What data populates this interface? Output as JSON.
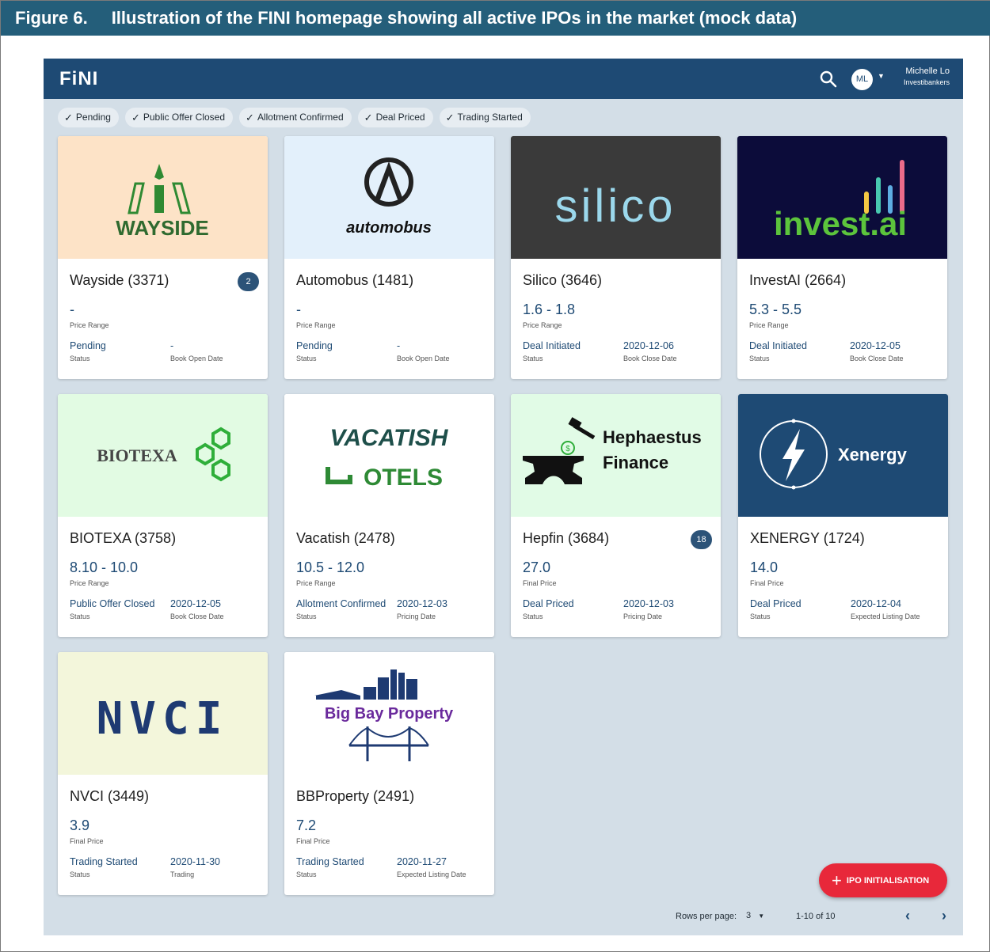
{
  "figure": {
    "number": "Figure 6.",
    "caption": "Illustration of the FINI homepage showing all active IPOs in the market (mock data)"
  },
  "appbar": {
    "logo": "FiNI",
    "user_initials": "ML",
    "user_name": "Michelle Lo",
    "user_org": "Investibankers"
  },
  "filters": [
    {
      "label": "Pending"
    },
    {
      "label": "Public Offer Closed"
    },
    {
      "label": "Allotment Confirmed"
    },
    {
      "label": "Deal Priced"
    },
    {
      "label": "Trading Started"
    }
  ],
  "cards": [
    {
      "title": "Wayside (3371)",
      "badge": "2",
      "price": "-",
      "price_label": "Price Range",
      "status": "Pending",
      "status_label": "Status",
      "date": "-",
      "date_label": "Book Open Date",
      "logo_text": "WAYSIDE",
      "bg": "#fde3c7"
    },
    {
      "title": "Automobus (1481)",
      "badge": "",
      "price": "-",
      "price_label": "Price Range",
      "status": "Pending",
      "status_label": "Status",
      "date": "-",
      "date_label": "Book Open Date",
      "logo_text": "automobus",
      "bg": "#e3f0fb"
    },
    {
      "title": "Silico (3646)",
      "badge": "",
      "price": "1.6 - 1.8",
      "price_label": "Price Range",
      "status": "Deal Initiated",
      "status_label": "Status",
      "date": "2020-12-06",
      "date_label": "Book Close Date",
      "logo_text": "silico",
      "bg": "#3a3a3a"
    },
    {
      "title": "InvestAI (2664)",
      "badge": "",
      "price": "5.3 - 5.5",
      "price_label": "Price Range",
      "status": "Deal Initiated",
      "status_label": "Status",
      "date": "2020-12-05",
      "date_label": "Book Close Date",
      "logo_text": "invest.ai",
      "bg": "#0c0c3a"
    },
    {
      "title": "BIOTEXA (3758)",
      "badge": "",
      "price": "8.10 - 10.0",
      "price_label": "Price Range",
      "status": "Public Offer Closed",
      "status_label": "Status",
      "date": "2020-12-05",
      "date_label": "Book Close Date",
      "logo_text": "BIOTEXA",
      "bg": "#e2fbe3"
    },
    {
      "title": "Vacatish (2478)",
      "badge": "",
      "price": "10.5 - 12.0",
      "price_label": "Price Range",
      "status": "Allotment Confirmed",
      "status_label": "Status",
      "date": "2020-12-03",
      "date_label": "Pricing Date",
      "logo_text": "VACATISH",
      "logo_text2": "OTELS",
      "bg": "#ffffff"
    },
    {
      "title": "Hepfin (3684)",
      "badge": "18",
      "price": "27.0",
      "price_label": "Final Price",
      "status": "Deal Priced",
      "status_label": "Status",
      "date": "2020-12-03",
      "date_label": "Pricing Date",
      "logo_text": "Hephaestus",
      "logo_text2": "Finance",
      "bg": "#e1fbe6"
    },
    {
      "title": "XENERGY (1724)",
      "badge": "",
      "price": "14.0",
      "price_label": "Final Price",
      "status": "Deal Priced",
      "status_label": "Status",
      "date": "2020-12-04",
      "date_label": "Expected Listing Date",
      "logo_text": "Xenergy",
      "bg": "#1e4a74"
    },
    {
      "title": "NVCI (3449)",
      "badge": "",
      "price": "3.9",
      "price_label": "Final Price",
      "status": "Trading Started",
      "status_label": "Status",
      "date": "2020-11-30",
      "date_label": "Trading",
      "logo_text": "NVCI",
      "bg": "#f3f6db"
    },
    {
      "title": "BBProperty (2491)",
      "badge": "",
      "price": "7.2",
      "price_label": "Final Price",
      "status": "Trading Started",
      "status_label": "Status",
      "date": "2020-11-27",
      "date_label": "Expected Listing Date",
      "logo_text": "Big Bay Property",
      "bg": "#ffffff"
    }
  ],
  "fab": {
    "label": "IPO INITIALISATION"
  },
  "pagination": {
    "rows_label": "Rows per page:",
    "rows_value": "3",
    "range": "1-10 of 10"
  },
  "colors": {
    "appbar": "#1e4a74",
    "background": "#d3dee7",
    "accent": "#e8283a",
    "caption_bar": "#245e7a"
  }
}
